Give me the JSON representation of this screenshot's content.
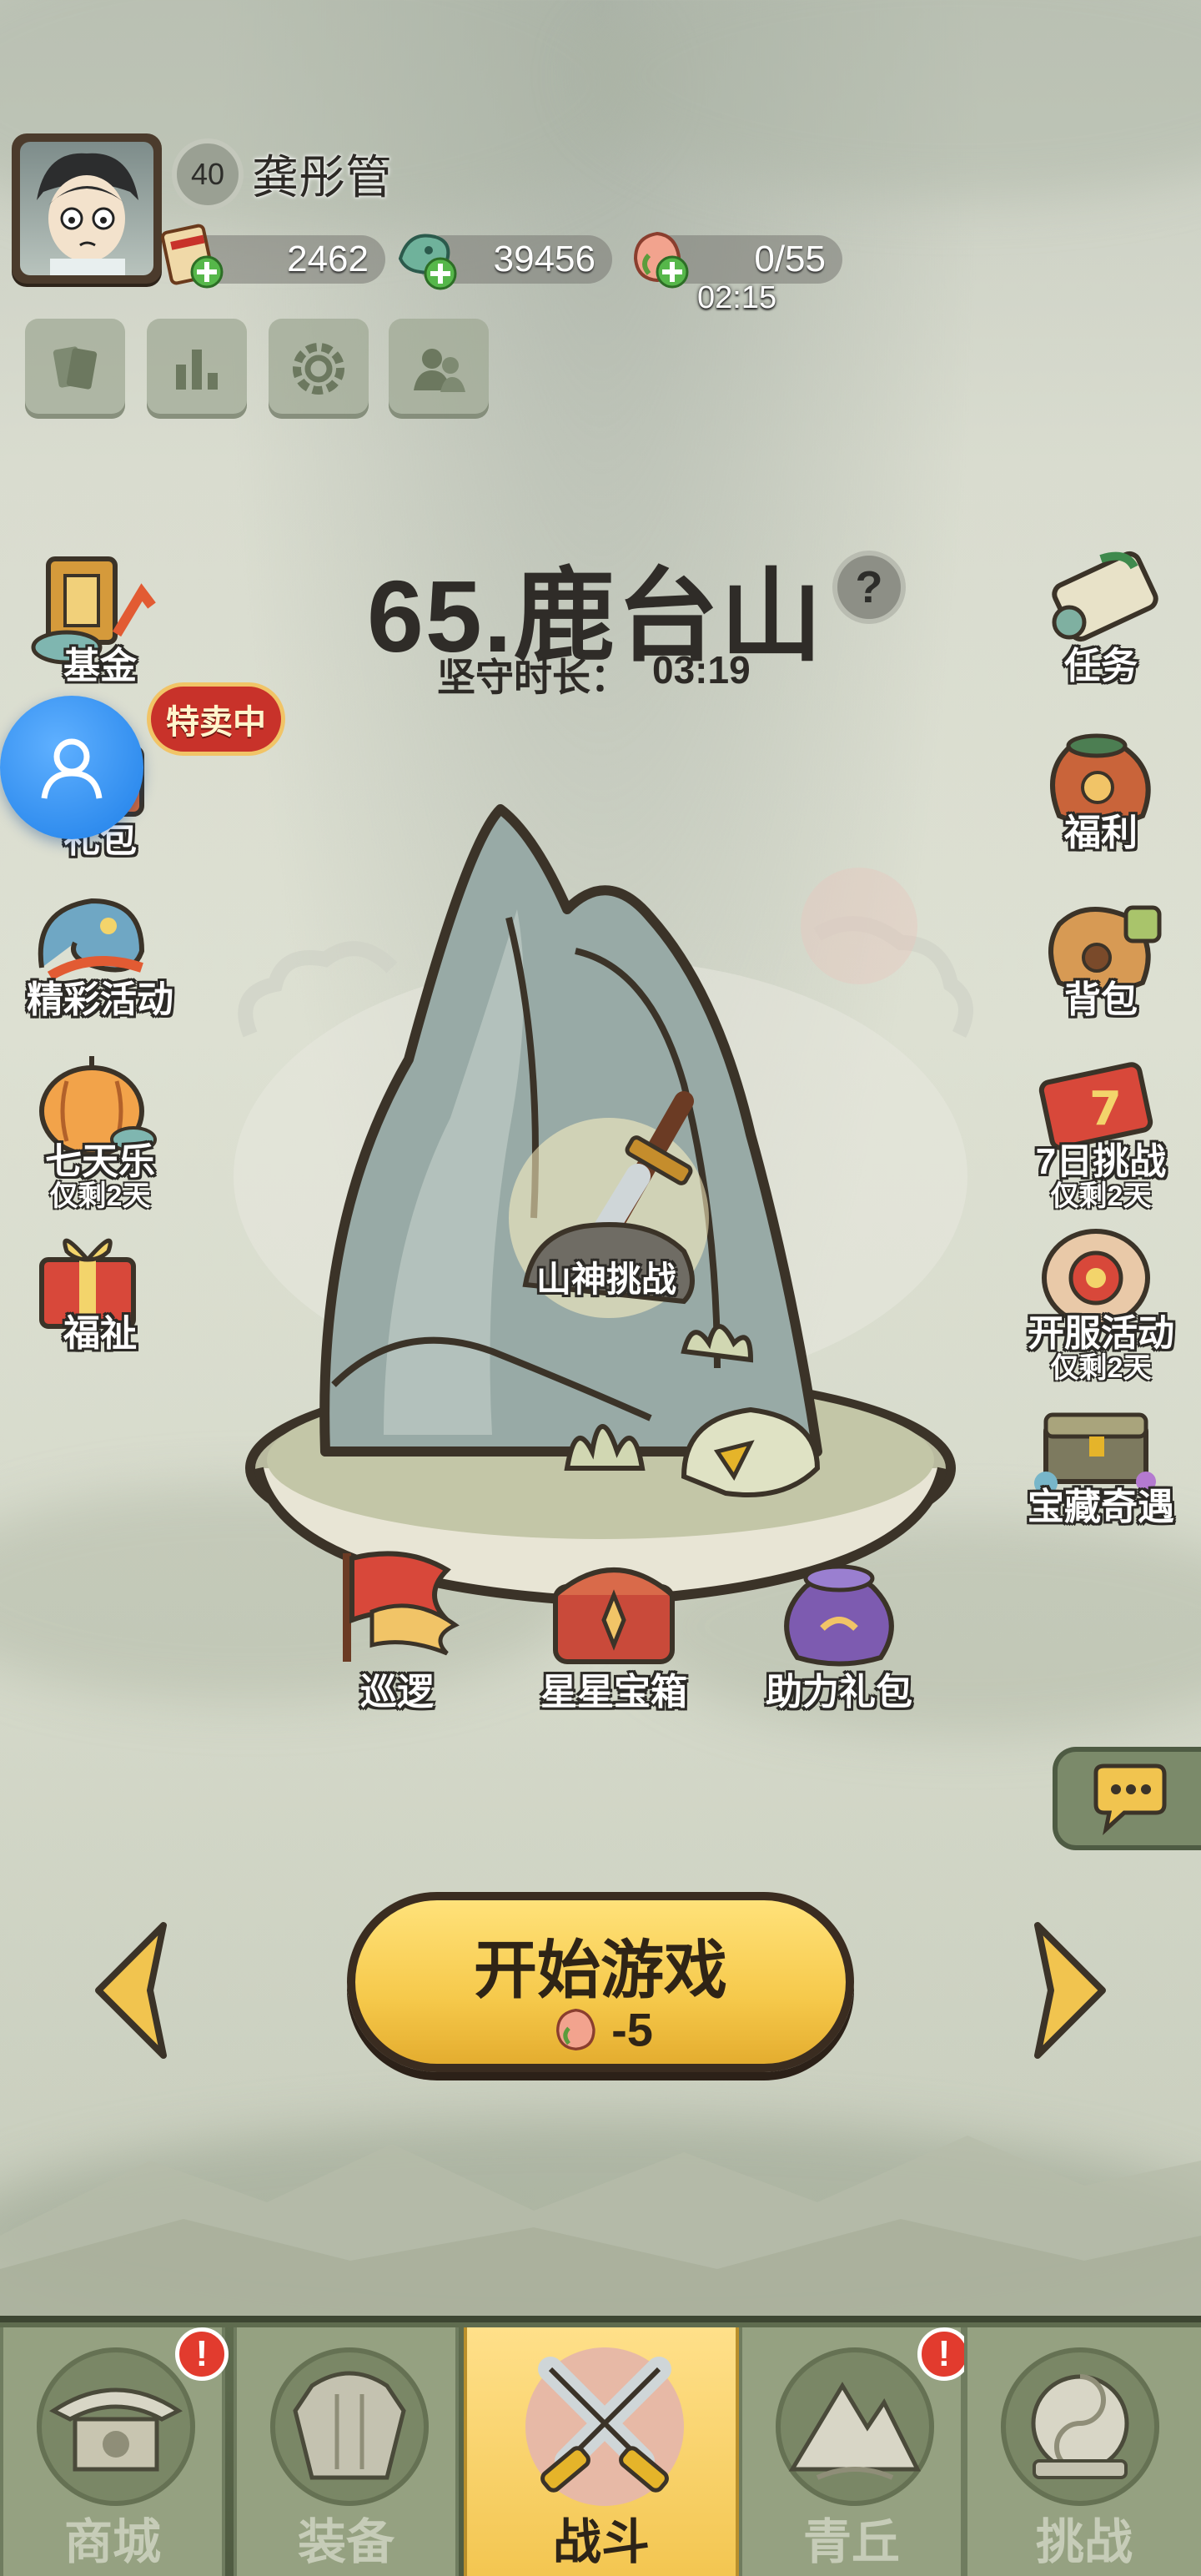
{
  "player": {
    "level": "40",
    "name": "龚彤管"
  },
  "resources": {
    "coupons": "2462",
    "jade": "39456",
    "stamina": "0/55",
    "stamina_timer": "02:15"
  },
  "stage": {
    "title": "65.鹿台山",
    "help_glyph": "?",
    "hold_label": "坚守时长：",
    "hold_time": "03:19",
    "challenge_label": "山神挑战"
  },
  "left_menu": {
    "fund": "基金",
    "gift": "礼包",
    "sale_badge": "特卖中",
    "events": "精彩活动",
    "seven_days": "七天乐",
    "seven_days_sub": "仅剩2天",
    "blessing": "福祉"
  },
  "right_menu": {
    "tasks": "任务",
    "welfare": "福利",
    "bag": "背包",
    "seven_challenge": "7日挑战",
    "seven_challenge_sub": "仅剩2天",
    "server_event": "开服活动",
    "server_event_sub": "仅剩2天",
    "treasure": "宝藏奇遇"
  },
  "actions": {
    "patrol": "巡逻",
    "star_chest": "星星宝箱",
    "assist_gift": "助力礼包"
  },
  "start": {
    "label": "开始游戏",
    "cost": "-5"
  },
  "nav": {
    "shop": "商城",
    "equip": "装备",
    "battle": "战斗",
    "hills": "青丘",
    "challenge": "挑战",
    "alert_glyph": "!"
  },
  "colors": {
    "accent_gold": "#f6c94b",
    "alert_red": "#e23b2e",
    "nav_green": "#5f6c4f"
  }
}
